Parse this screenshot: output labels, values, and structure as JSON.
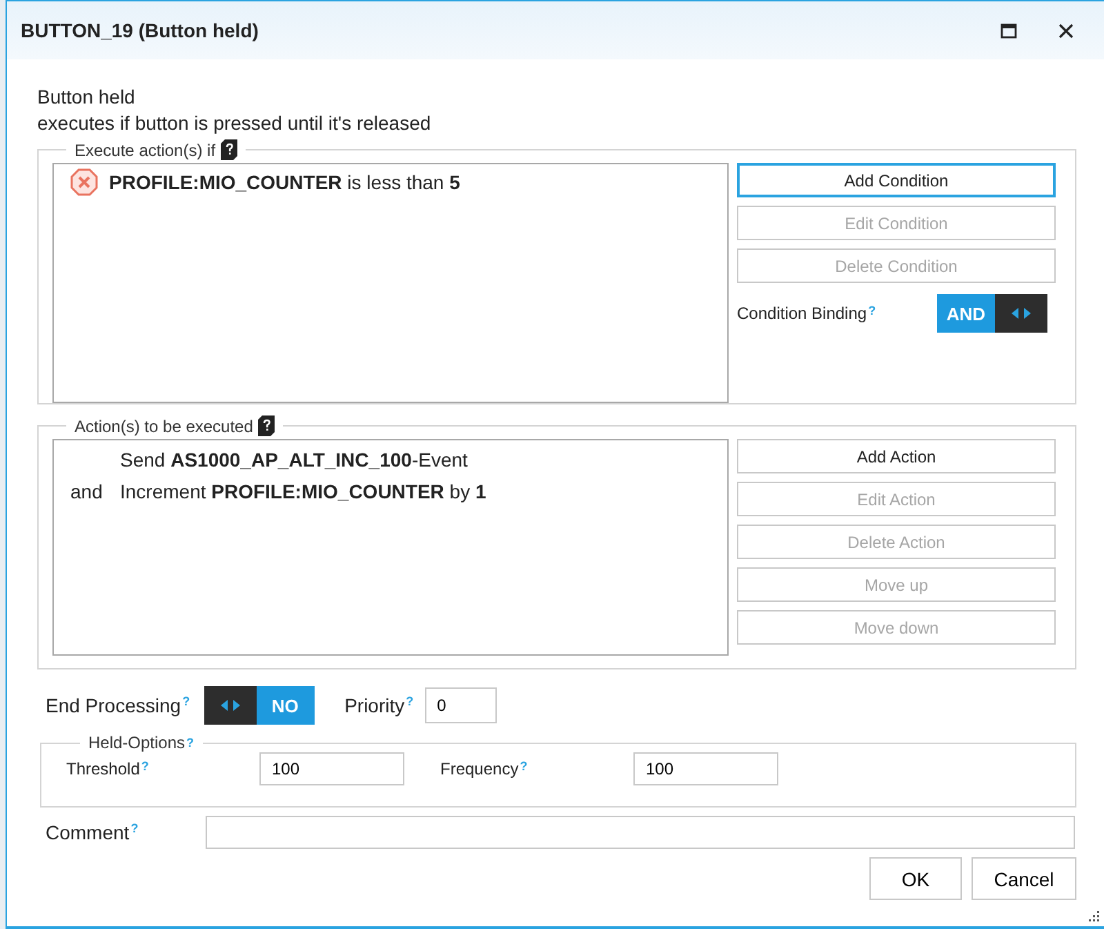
{
  "window": {
    "title": "BUTTON_19 (Button held)"
  },
  "description": [
    "Button held",
    "executes if button is pressed until it's released"
  ],
  "conditions_group": {
    "legend": "Execute action(s) if",
    "conditions": [
      {
        "kind": "error",
        "text": "**PROFILE:MIO_COUNTER** is less than **5**"
      }
    ],
    "buttons": [
      {
        "label": "Add Condition",
        "disabled": false,
        "focused": true
      },
      {
        "label": "Edit Condition",
        "disabled": true,
        "focused": false
      },
      {
        "label": "Delete Condition",
        "disabled": true,
        "focused": false
      }
    ],
    "binding": {
      "label": "Condition Binding",
      "help": "?",
      "value": "AND",
      "on": true
    }
  },
  "actions_group": {
    "legend": "Action(s) to be executed",
    "actions": [
      {
        "text": "Send **AS1000_AP_ALT_INC_100**-Event"
      },
      {
        "joiner": "and",
        "text": "Increment **PROFILE:MIO_COUNTER** by **1**"
      }
    ],
    "buttons": [
      {
        "label": "Add Action",
        "disabled": false,
        "focused": false
      },
      {
        "label": "Edit Action",
        "disabled": true,
        "focused": false
      },
      {
        "label": "Delete Action",
        "disabled": true,
        "focused": false
      },
      {
        "label": "Move up",
        "disabled": true,
        "focused": false
      },
      {
        "label": "Move down",
        "disabled": true,
        "focused": false
      }
    ]
  },
  "end_processing": {
    "label": "End Processing",
    "help": "?",
    "value": "NO",
    "on": false
  },
  "priority": {
    "label": "Priority",
    "help": "?",
    "value": "0"
  },
  "held_options": {
    "legend": "Held-Options",
    "help": "?",
    "fields": [
      {
        "label": "Threshold",
        "help": "?",
        "value": "100"
      },
      {
        "label": "Frequency",
        "help": "?",
        "value": "100"
      }
    ]
  },
  "comment": {
    "label": "Comment",
    "help": "?"
  },
  "footer_buttons": [
    "OK",
    "Cancel"
  ]
}
